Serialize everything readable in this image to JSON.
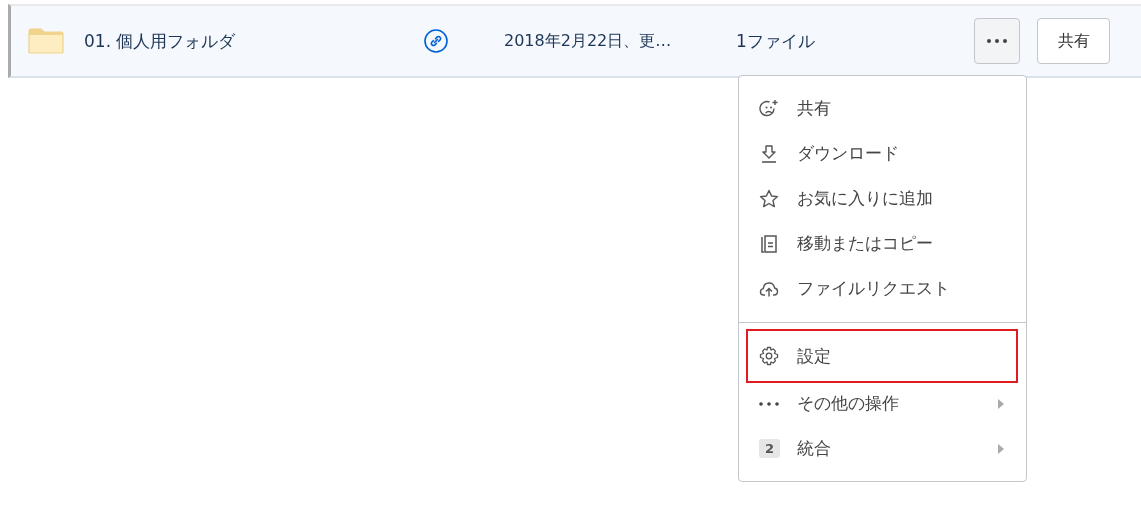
{
  "row": {
    "name": "01. 個人用フォルダ",
    "shared_link": true,
    "date": "2018年2月22日、更…",
    "count": "1ファイル",
    "more_button": {
      "selected": true
    },
    "share_button": "共有"
  },
  "menu": {
    "groups": [
      {
        "items": [
          {
            "kind": "share",
            "label": "共有",
            "submenu": false,
            "highlighted": false
          },
          {
            "kind": "download",
            "label": "ダウンロード",
            "submenu": false,
            "highlighted": false
          },
          {
            "kind": "star",
            "label": "お気に入りに追加",
            "submenu": false,
            "highlighted": false
          },
          {
            "kind": "copy",
            "label": "移動またはコピー",
            "submenu": false,
            "highlighted": false
          },
          {
            "kind": "upload",
            "label": "ファイルリクエスト",
            "submenu": false,
            "highlighted": false
          }
        ]
      },
      {
        "items": [
          {
            "kind": "gear",
            "label": "設定",
            "submenu": false,
            "highlighted": true
          },
          {
            "kind": "dots",
            "label": "その他の操作",
            "submenu": true,
            "highlighted": false
          },
          {
            "kind": "badge",
            "badge": "2",
            "label": "統合",
            "submenu": true,
            "highlighted": false
          }
        ]
      }
    ]
  }
}
